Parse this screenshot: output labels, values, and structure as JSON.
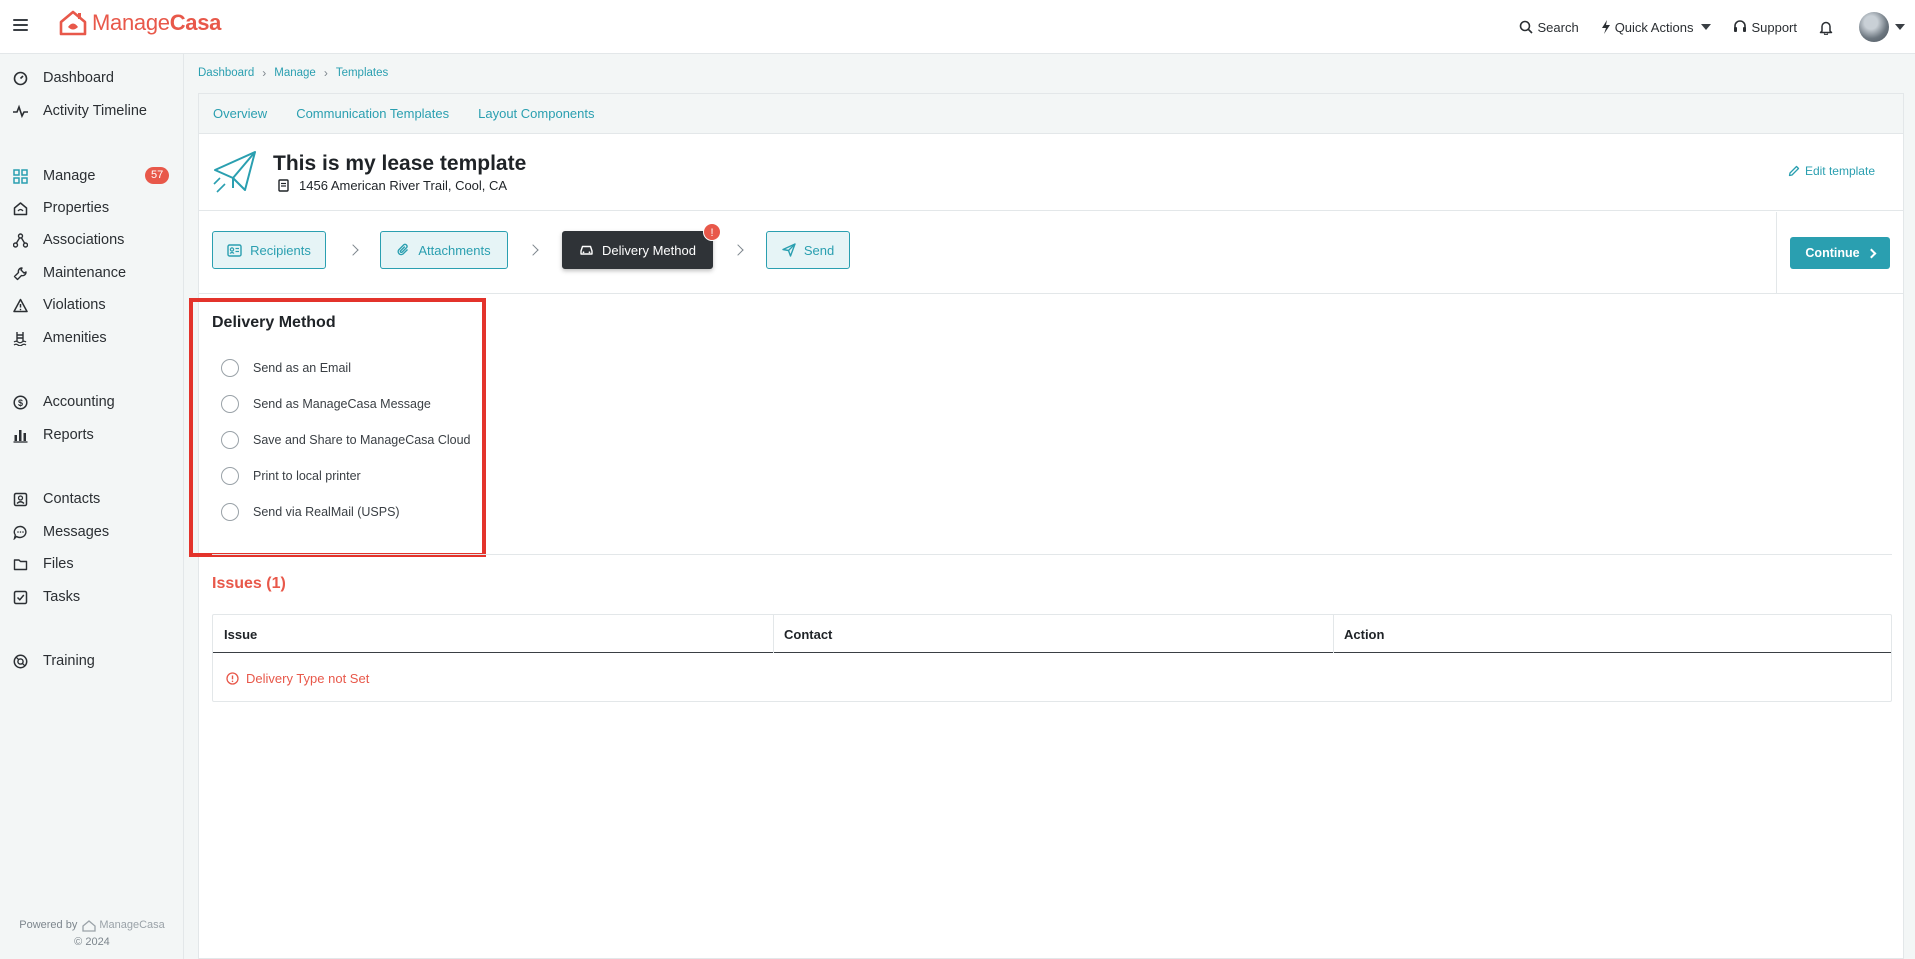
{
  "app": {
    "logo_prefix": "Manage",
    "logo_suffix": "Casa",
    "brand_color": "#e8584a",
    "accent_color": "#2a9fb0"
  },
  "topnav": {
    "search": "Search",
    "quick_actions": "Quick Actions",
    "support": "Support"
  },
  "sidebar": {
    "items": [
      {
        "label": "Dashboard",
        "icon": "gauge-icon"
      },
      {
        "label": "Activity Timeline",
        "icon": "pulse-icon"
      },
      {
        "label": "Manage",
        "icon": "grid-icon",
        "badge": "57"
      },
      {
        "label": "Properties",
        "icon": "house-icon"
      },
      {
        "label": "Associations",
        "icon": "network-icon"
      },
      {
        "label": "Maintenance",
        "icon": "wrench-icon"
      },
      {
        "label": "Violations",
        "icon": "warning-icon"
      },
      {
        "label": "Amenities",
        "icon": "pool-icon"
      },
      {
        "label": "Accounting",
        "icon": "dollar-icon"
      },
      {
        "label": "Reports",
        "icon": "bar-chart-icon"
      },
      {
        "label": "Contacts",
        "icon": "contact-card-icon"
      },
      {
        "label": "Messages",
        "icon": "chat-icon"
      },
      {
        "label": "Files",
        "icon": "folder-icon"
      },
      {
        "label": "Tasks",
        "icon": "checkbox-icon"
      },
      {
        "label": "Training",
        "icon": "lifebuoy-icon"
      }
    ],
    "powered_by": "Powered by",
    "powered_brand": "ManageCasa",
    "copyright": "© 2024"
  },
  "breadcrumb": [
    "Dashboard",
    "Manage",
    "Templates"
  ],
  "tabs": [
    "Overview",
    "Communication Templates",
    "Layout Components"
  ],
  "template": {
    "title": "This is my lease template",
    "address": "1456 American River Trail, Cool, CA",
    "edit_label": "Edit template"
  },
  "steps": [
    {
      "label": "Recipients",
      "icon": "id-card-icon",
      "active": false
    },
    {
      "label": "Attachments",
      "icon": "paperclip-icon",
      "active": false
    },
    {
      "label": "Delivery Method",
      "icon": "car-icon",
      "active": true,
      "alert": "!"
    },
    {
      "label": "Send",
      "icon": "send-icon",
      "active": false
    }
  ],
  "continue_label": "Continue",
  "delivery": {
    "title": "Delivery Method",
    "options": [
      "Send as an Email",
      "Send as ManageCasa Message",
      "Save and Share to ManageCasa Cloud",
      "Print to local printer",
      "Send via RealMail (USPS)"
    ],
    "selected": null
  },
  "issues": {
    "title": "Issues (1)",
    "columns": [
      "Issue",
      "Contact",
      "Action"
    ],
    "rows": [
      {
        "issue": "Delivery Type not Set",
        "contact": "",
        "action": ""
      }
    ]
  }
}
